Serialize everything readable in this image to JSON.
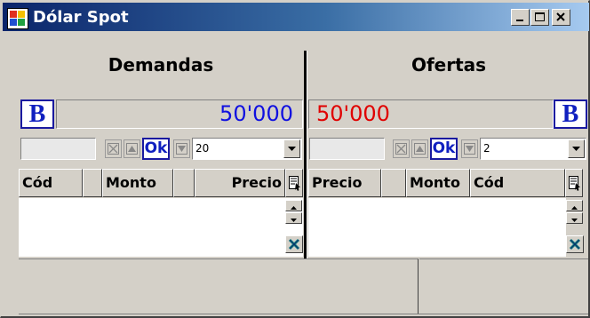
{
  "window": {
    "title": "Dólar Spot",
    "minimize_label": "_",
    "maximize_label": "□",
    "close_label": "✕"
  },
  "demandas": {
    "header": "Demandas",
    "b_label": "B",
    "amount": "50'000",
    "amount_color": "#1010e0",
    "ok_label": "Ok",
    "count_value": "20",
    "columns": [
      "Cód",
      "Monto",
      "Precio"
    ]
  },
  "ofertas": {
    "header": "Ofertas",
    "b_label": "B",
    "amount": "50'000",
    "amount_color": "#e00000",
    "ok_label": "Ok",
    "count_value": "2",
    "columns": [
      "Precio",
      "Monto",
      "Cód"
    ]
  },
  "icons": {
    "app": "currency-app-icon",
    "clear": "clear-x-icon",
    "up": "arrow-up-icon",
    "down": "arrow-down-icon",
    "column_chooser": "column-chooser-icon",
    "grid_clear": "grid-clear-icon"
  },
  "colors": {
    "title_bar_start": "#0a246a",
    "title_bar_end": "#a6caf0",
    "face": "#d4d0c8",
    "accent_blue": "#1020c0"
  }
}
